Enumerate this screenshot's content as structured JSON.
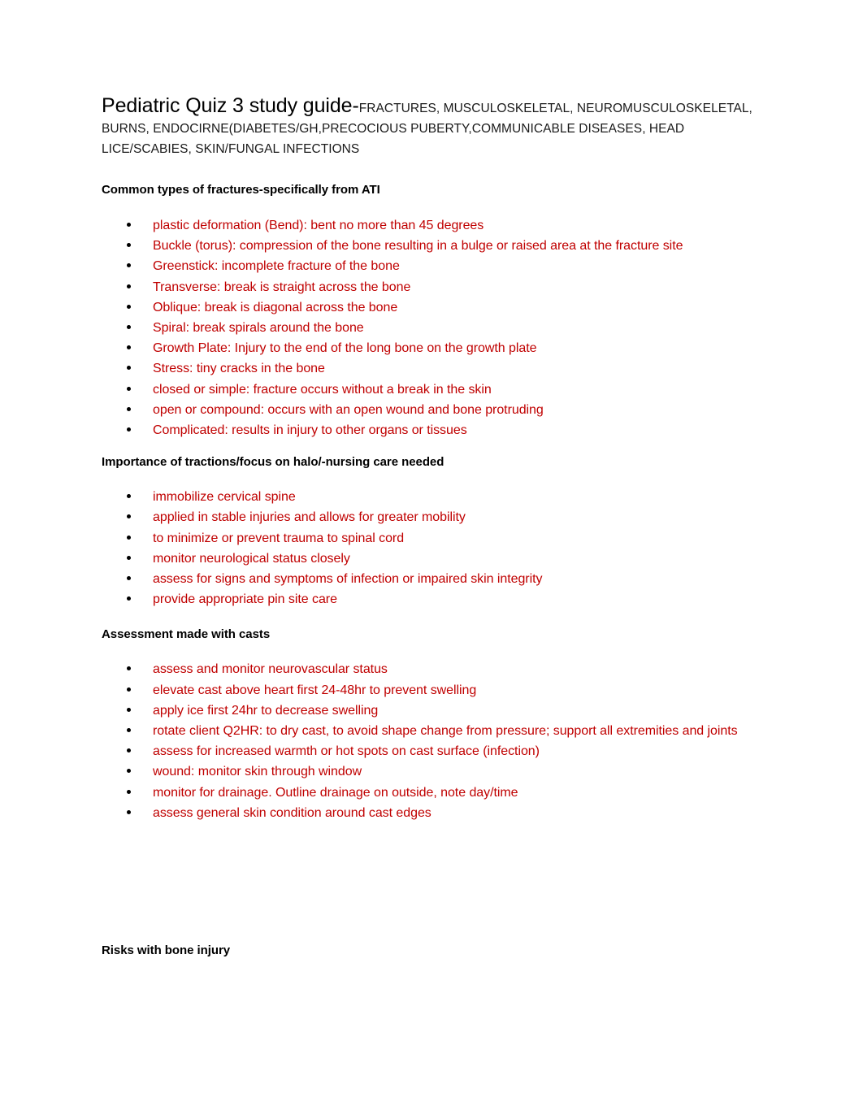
{
  "document": {
    "title_main": "Pediatric Quiz 3 study guide-",
    "title_sub": "FRACTURES, MUSCULOSKELETAL, NEUROMUSCULOSKELETAL, BURNS, ENDOCIRNE(DIABETES/GH,PRECOCIOUS PUBERTY,COMMUNICABLE DISEASES, HEAD LICE/SCABIES, SKIN/FUNGAL INFECTIONS",
    "text_color_body": "#C00000",
    "text_color_heading": "#000000",
    "bullet_color": "#000000",
    "background": "#FFFFFF"
  },
  "sections": [
    {
      "heading": "Common types of fractures-specifically from ATI",
      "bullets": [
        "plastic deformation (Bend): bent no more than 45 degrees",
        "Buckle (torus): compression of the bone resulting in a bulge or raised area at the fracture site",
        "Greenstick: incomplete fracture of the bone",
        "Transverse: break is straight across the bone",
        "Oblique: break is diagonal across the bone",
        "Spiral: break spirals around the bone",
        "Growth Plate: Injury to the end of the long bone on the growth plate",
        "Stress: tiny cracks in the bone",
        "closed or simple: fracture occurs without a break in the skin",
        "open or compound: occurs with an open wound and bone protruding",
        "Complicated: results in injury to other organs or tissues"
      ]
    },
    {
      "heading": "Importance of tractions/focus on halo/-nursing care needed",
      "bullets": [
        "immobilize cervical spine",
        "applied in stable injuries and allows for greater mobility",
        "to minimize or prevent trauma to spinal cord",
        "monitor neurological status closely",
        "assess for signs and symptoms of infection or impaired skin integrity",
        "provide appropriate pin site care"
      ]
    },
    {
      "heading": "Assessment made with casts",
      "bullets": [
        "assess and monitor neurovascular status",
        "elevate cast above heart first 24-48hr to prevent swelling",
        "apply ice first 24hr to decrease swelling",
        "rotate client Q2HR: to dry cast, to avoid shape change from pressure; support all extremities and joints",
        "assess for increased warmth or hot spots on cast surface (infection)",
        "wound: monitor skin through window",
        "monitor for drainage. Outline drainage on outside, note day/time",
        "assess general skin condition around cast edges"
      ]
    },
    {
      "heading": "Risks with bone injury",
      "bullets": []
    }
  ]
}
